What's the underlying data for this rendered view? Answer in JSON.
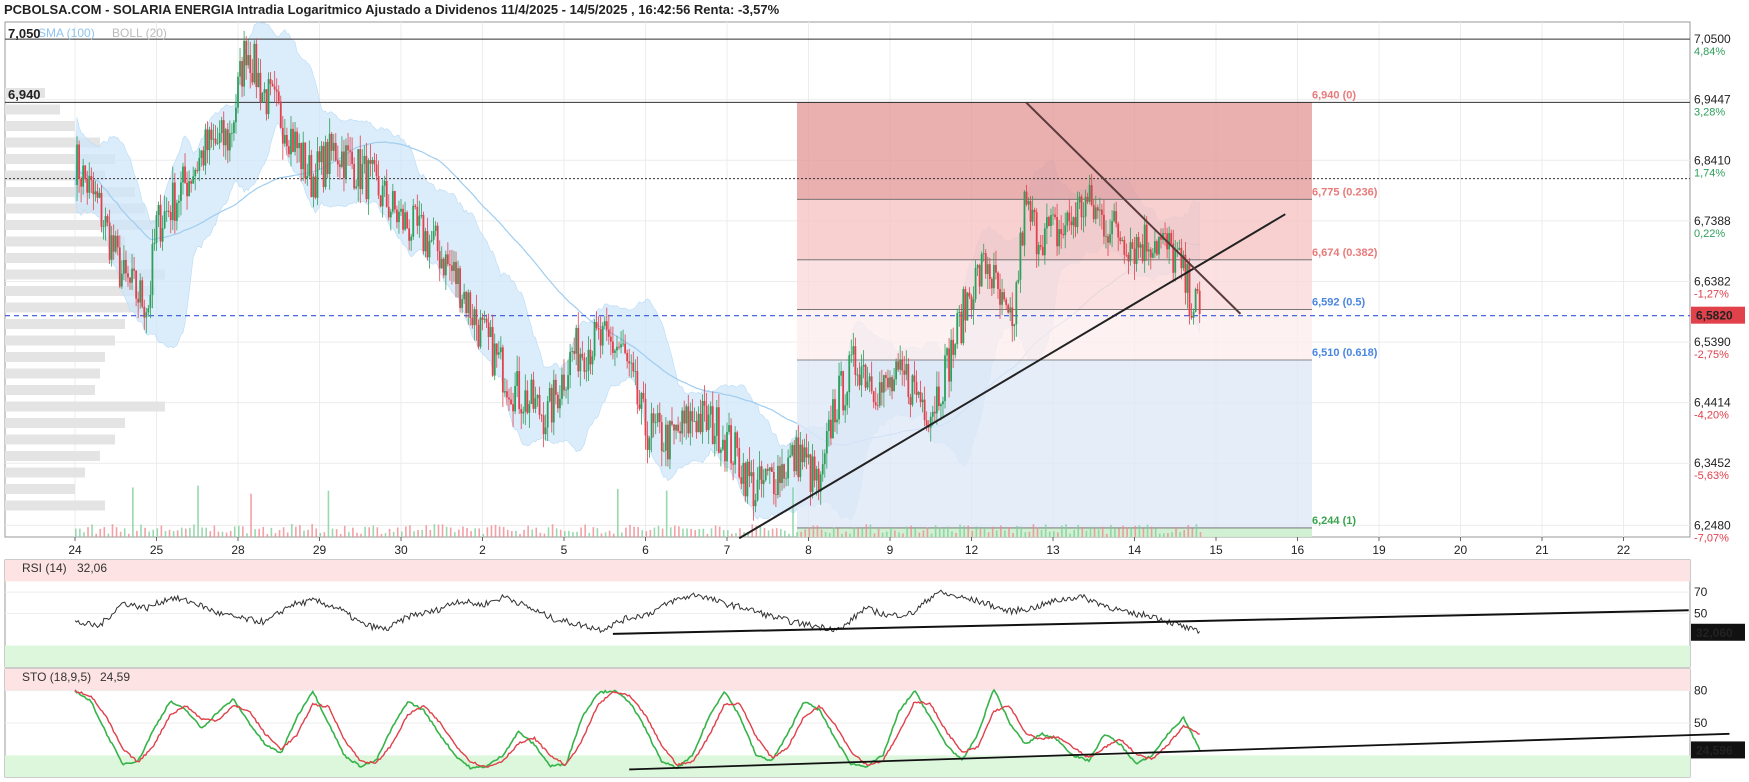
{
  "header": {
    "title": "PCBOLSA.COM - SOLARIA ENERGIA Intradia Logaritmico Ajustado a Dividenos 11/4/2025 - 14/5/2025 , 16:42:56 Renta: -3,57%"
  },
  "colors": {
    "up": "#2e9e5b",
    "down": "#e0414b",
    "boll_fill": "#cfe6fa",
    "sma": "#9fcdf0",
    "fib_red": "#e79a9a",
    "fib_blue": "#a9c9f5",
    "current": "#e0414b",
    "rsi_line": "#333333",
    "sto_k": "#37b34a",
    "sto_d": "#e0414b"
  },
  "chart_data": [
    {
      "type": "candlestick",
      "panel": "price",
      "scale": "log",
      "legend": [
        "SMA (100)",
        "BOLL (20)"
      ],
      "x_ticks": [
        "24",
        "25",
        "28",
        "29",
        "30",
        "2",
        "5",
        "6",
        "7",
        "8",
        "9",
        "12",
        "13",
        "14",
        "15",
        "16",
        "19",
        "20",
        "21",
        "22"
      ],
      "y_ticks": [
        {
          "value": "7,0500",
          "pct": "4,84%"
        },
        {
          "value": "6,9447",
          "pct": "3,28%"
        },
        {
          "value": "6,8410",
          "pct": "1,74%"
        },
        {
          "value": "6,7388",
          "pct": "0,22%"
        },
        {
          "value": "6,6382",
          "pct": "-1,27%"
        },
        {
          "value": "6,5390",
          "pct": "-2,75%"
        },
        {
          "value": "6,4414",
          "pct": "-4,20%"
        },
        {
          "value": "6,3452",
          "pct": "-5,63%"
        },
        {
          "value": "6,2480",
          "pct": "-7,07%"
        }
      ],
      "ylim": [
        6.23,
        7.08
      ],
      "current_price": "6,5820",
      "left_levels": [
        "7,050",
        "6,940"
      ],
      "fibonacci": [
        {
          "label": "6,940 (0)",
          "value": 6.94
        },
        {
          "label": "6,775 (0.236)",
          "value": 6.775
        },
        {
          "label": "6,674 (0.382)",
          "value": 6.674
        },
        {
          "label": "6,592 (0.5)",
          "value": 6.592
        },
        {
          "label": "6,510 (0.618)",
          "value": 6.51
        },
        {
          "label": "6,244 (1)",
          "value": 6.244
        }
      ],
      "close_path": [
        [
          0,
          6.84
        ],
        [
          0.3,
          6.76
        ],
        [
          0.6,
          6.64
        ],
        [
          0.9,
          6.6
        ],
        [
          1.0,
          6.73
        ],
        [
          1.3,
          6.79
        ],
        [
          1.6,
          6.86
        ],
        [
          1.9,
          6.88
        ],
        [
          2.1,
          7.04
        ],
        [
          2.3,
          6.96
        ],
        [
          2.6,
          6.9
        ],
        [
          2.9,
          6.81
        ],
        [
          3.2,
          6.86
        ],
        [
          3.6,
          6.81
        ],
        [
          4.0,
          6.74
        ],
        [
          4.4,
          6.7
        ],
        [
          4.7,
          6.64
        ],
        [
          5.0,
          6.55
        ],
        [
          5.4,
          6.46
        ],
        [
          5.8,
          6.42
        ],
        [
          6.1,
          6.52
        ],
        [
          6.4,
          6.54
        ],
        [
          6.7,
          6.53
        ],
        [
          7.0,
          6.4
        ],
        [
          7.3,
          6.38
        ],
        [
          7.6,
          6.42
        ],
        [
          7.9,
          6.4
        ],
        [
          8.1,
          6.36
        ],
        [
          8.35,
          6.3
        ],
        [
          8.6,
          6.33
        ],
        [
          8.9,
          6.36
        ],
        [
          9.15,
          6.3
        ],
        [
          9.3,
          6.43
        ],
        [
          9.6,
          6.51
        ],
        [
          9.9,
          6.46
        ],
        [
          10.2,
          6.48
        ],
        [
          10.5,
          6.43
        ],
        [
          10.7,
          6.5
        ],
        [
          11.0,
          6.63
        ],
        [
          11.2,
          6.67
        ],
        [
          11.35,
          6.6
        ],
        [
          11.5,
          6.55
        ],
        [
          11.65,
          6.76
        ],
        [
          11.8,
          6.72
        ],
        [
          12.1,
          6.72
        ],
        [
          12.4,
          6.77
        ],
        [
          12.7,
          6.73
        ],
        [
          13.0,
          6.7
        ],
        [
          13.25,
          6.71
        ],
        [
          13.5,
          6.68
        ],
        [
          13.7,
          6.61
        ],
        [
          13.8,
          6.585
        ]
      ],
      "drawn_lines": [
        {
          "name": "uptrend",
          "from": [
            8.15,
            6.228
          ],
          "to": [
            14.85,
            6.75
          ]
        },
        {
          "name": "downtrend",
          "from": [
            11.67,
            6.94
          ],
          "to": [
            14.3,
            6.585
          ]
        }
      ]
    },
    {
      "type": "line",
      "panel": "oscillator",
      "name": "RSI (14)",
      "value_label": "32,06",
      "current": "32,060",
      "levels": [
        70,
        50
      ],
      "ylim": [
        0,
        100
      ],
      "series": [
        42,
        38,
        60,
        55,
        65,
        60,
        50,
        45,
        42,
        58,
        62,
        55,
        40,
        35,
        48,
        52,
        62,
        58,
        66,
        55,
        45,
        40,
        35,
        45,
        50,
        62,
        68,
        60,
        55,
        48,
        42,
        38,
        35,
        55,
        48,
        50,
        70,
        65,
        60,
        52,
        55,
        62,
        66,
        58,
        50,
        48,
        40,
        32
      ],
      "trend_line": {
        "from": [
          6.6,
          31
        ],
        "to": [
          19.8,
          53
        ]
      }
    },
    {
      "type": "line",
      "panel": "oscillator",
      "name": "STO (18,9,5)",
      "value_label": "24,59",
      "current": "24,596",
      "levels": [
        80,
        50
      ],
      "ylim": [
        0,
        100
      ],
      "k": [
        80,
        70,
        40,
        12,
        15,
        45,
        70,
        62,
        45,
        60,
        72,
        50,
        30,
        22,
        55,
        80,
        50,
        20,
        10,
        15,
        45,
        70,
        62,
        40,
        20,
        8,
        10,
        20,
        42,
        30,
        10,
        12,
        55,
        78,
        80,
        70,
        45,
        15,
        8,
        20,
        55,
        80,
        55,
        20,
        15,
        40,
        70,
        62,
        35,
        12,
        10,
        20,
        60,
        80,
        55,
        30,
        15,
        40,
        82,
        50,
        30,
        40,
        35,
        20,
        15,
        40,
        30,
        12,
        20,
        40,
        55,
        25
      ],
      "trend_line": {
        "from": [
          6.8,
          7
        ],
        "to": [
          20.3,
          40
        ]
      }
    }
  ]
}
